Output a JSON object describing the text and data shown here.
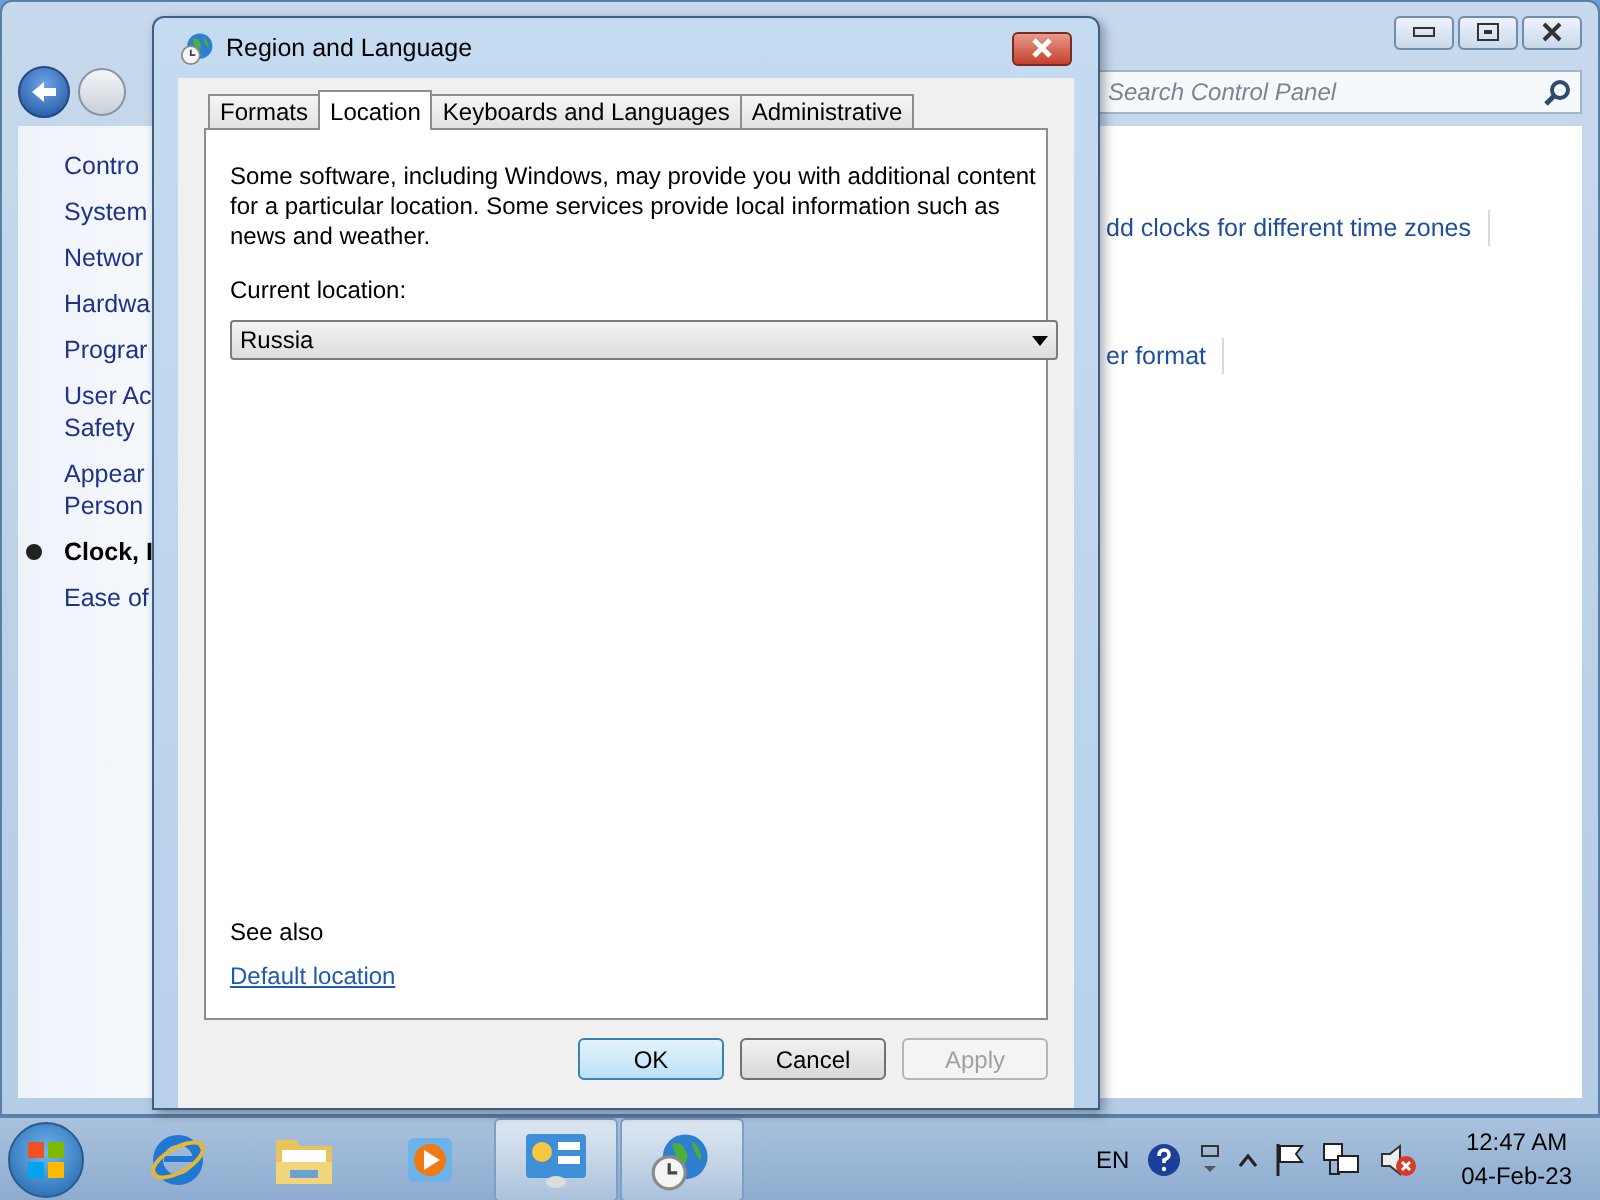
{
  "control_panel": {
    "search": {
      "placeholder": "Search Control Panel"
    },
    "sidebar": {
      "items": [
        {
          "lines": [
            "Contro"
          ],
          "selected": false
        },
        {
          "lines": [
            "System"
          ],
          "selected": false
        },
        {
          "lines": [
            "Networ"
          ],
          "selected": false
        },
        {
          "lines": [
            "Hardwa"
          ],
          "selected": false
        },
        {
          "lines": [
            "Prograr"
          ],
          "selected": false
        },
        {
          "lines": [
            "User Ac",
            "Safety"
          ],
          "selected": false
        },
        {
          "lines": [
            "Appear",
            "Person"
          ],
          "selected": false
        },
        {
          "lines": [
            "Clock, I"
          ],
          "selected": true
        },
        {
          "lines": [
            "Ease of"
          ],
          "selected": false
        }
      ]
    },
    "links": [
      "dd clocks for different time zones",
      "er format"
    ]
  },
  "dialog": {
    "title": "Region and Language",
    "tabs": [
      {
        "label": "Formats",
        "selected": false
      },
      {
        "label": "Location",
        "selected": true
      },
      {
        "label": "Keyboards and Languages",
        "selected": false
      },
      {
        "label": "Administrative",
        "selected": false
      }
    ],
    "intro": "Some software, including Windows, may provide you with additional content for a particular location. Some services provide local information such as news and weather.",
    "location_label": "Current location:",
    "location": {
      "value": "Russia"
    },
    "see_also": "See also",
    "link": "Default location",
    "buttons": [
      {
        "label": "OK",
        "default": true,
        "disabled": false
      },
      {
        "label": "Cancel",
        "default": false,
        "disabled": false
      },
      {
        "label": "Apply",
        "default": false,
        "disabled": true
      }
    ]
  },
  "taskbar": {
    "apps": [
      {
        "kind": "browser",
        "active": false
      },
      {
        "kind": "folder",
        "active": false
      },
      {
        "kind": "media",
        "active": false
      },
      {
        "kind": "control",
        "active": true
      },
      {
        "kind": "region",
        "active": true
      }
    ],
    "tray": {
      "language": "EN",
      "time": "12:47 AM",
      "date": "04-Feb-23"
    }
  }
}
